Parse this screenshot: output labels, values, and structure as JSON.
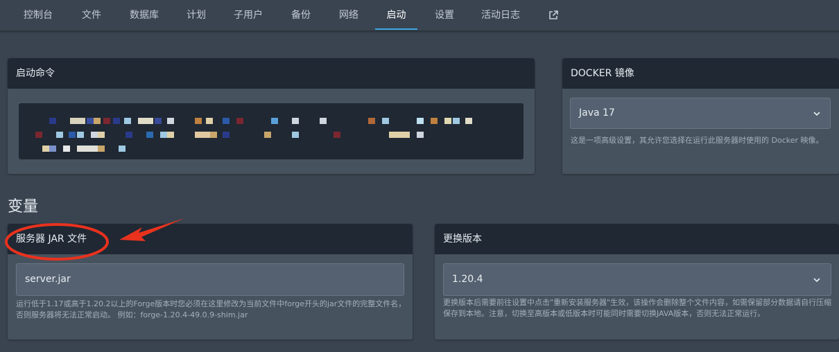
{
  "nav": {
    "tabs": [
      "控制台",
      "文件",
      "数据库",
      "计划",
      "子用户",
      "备份",
      "网络",
      "启动",
      "设置",
      "活动日志"
    ],
    "active_index": 7,
    "external_icon": "external-link-icon"
  },
  "startup_command": {
    "title": "启动命令"
  },
  "docker": {
    "title": "DOCKER 镜像",
    "selected": "Java 17",
    "help": "这是一项高级设置，其允许您选择在运行此服务器时使用的 Docker 映像。"
  },
  "variables": {
    "title": "变量",
    "jar": {
      "title": "服务器 JAR 文件",
      "value": "server.jar",
      "help": "运行低于1.17或高于1.20.2以上的Forge版本时您必须在这里修改为当前文件中forge开头的jar文件的完整文件名，否则服务器将无法正常启动。 例如：forge-1.20.4-49.0.9-shim.jar"
    },
    "version": {
      "title": "更换版本",
      "value": "1.20.4",
      "help": "更换版本后需要前往设置中点击\"重新安装服务器\"生效，该操作会删除整个文件内容，如需保留部分数据请自行压缩保存到本地。注意，切换至高版本或低版本时可能同时需要切换JAVA版本，否则无法正常运行。"
    }
  },
  "colors": {
    "accent": "#3ea7e0",
    "annotation": "#e8321e",
    "card_header": "#1f2833",
    "background": "#3a4450"
  }
}
